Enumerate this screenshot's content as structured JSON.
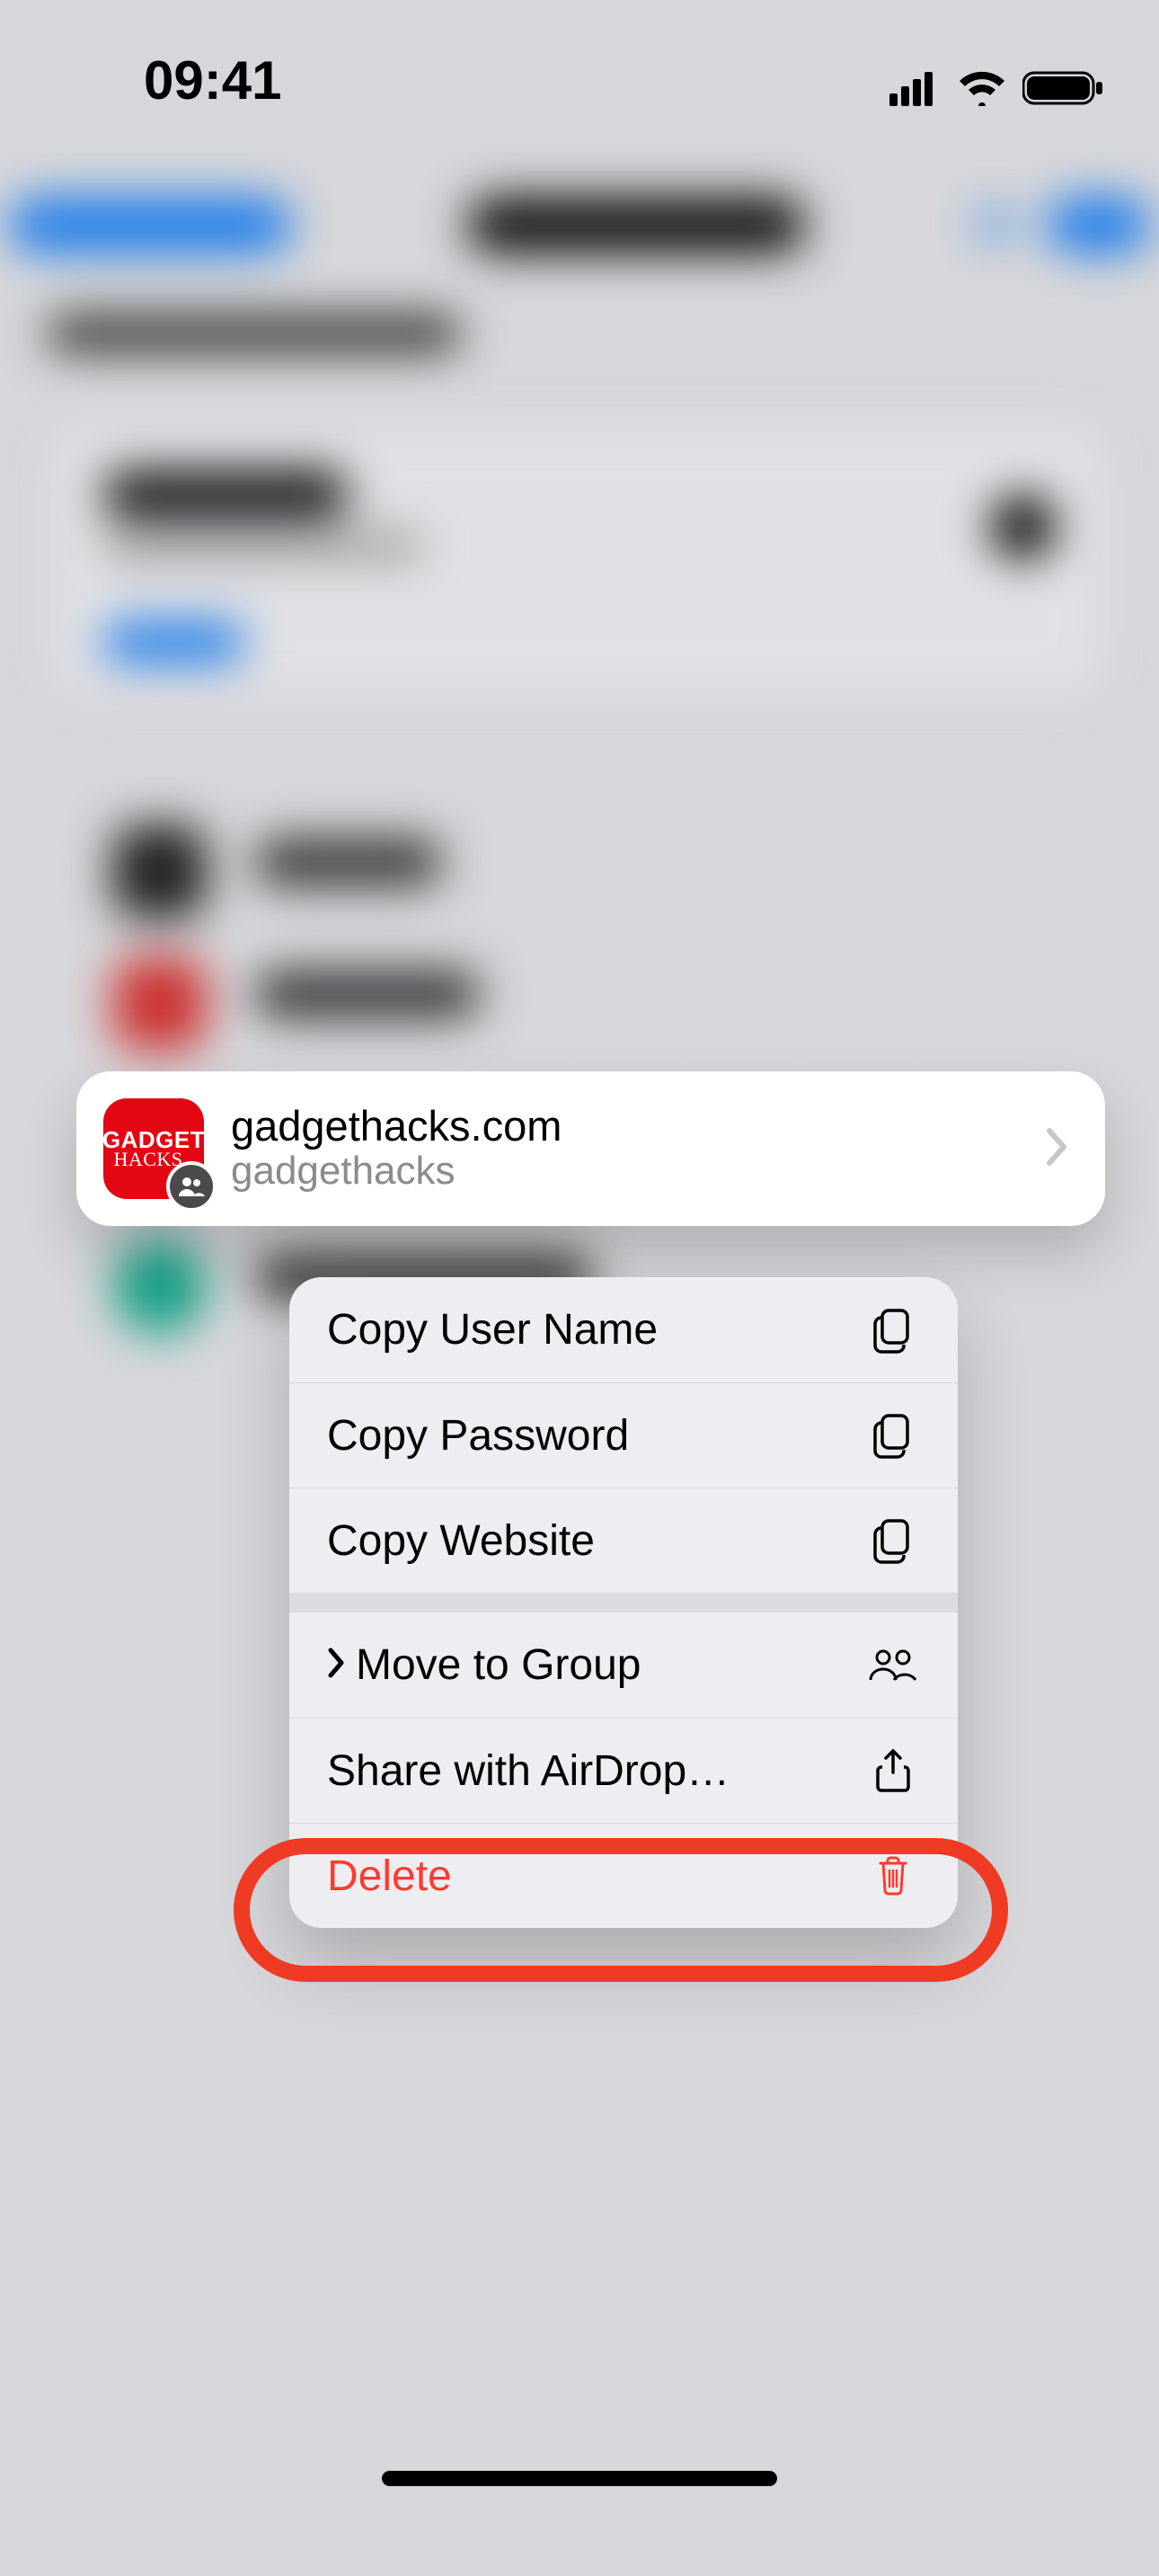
{
  "status": {
    "time": "09:41"
  },
  "preview": {
    "icon_text_top": "GADGET",
    "icon_text_bottom": "HACKS",
    "title": "gadgethacks.com",
    "subtitle": "gadgethacks"
  },
  "menu": {
    "copy_user_name": "Copy User Name",
    "copy_password": "Copy Password",
    "copy_website": "Copy Website",
    "move_to_group": "Move to Group",
    "share_airdrop": "Share with AirDrop…",
    "delete": "Delete"
  }
}
